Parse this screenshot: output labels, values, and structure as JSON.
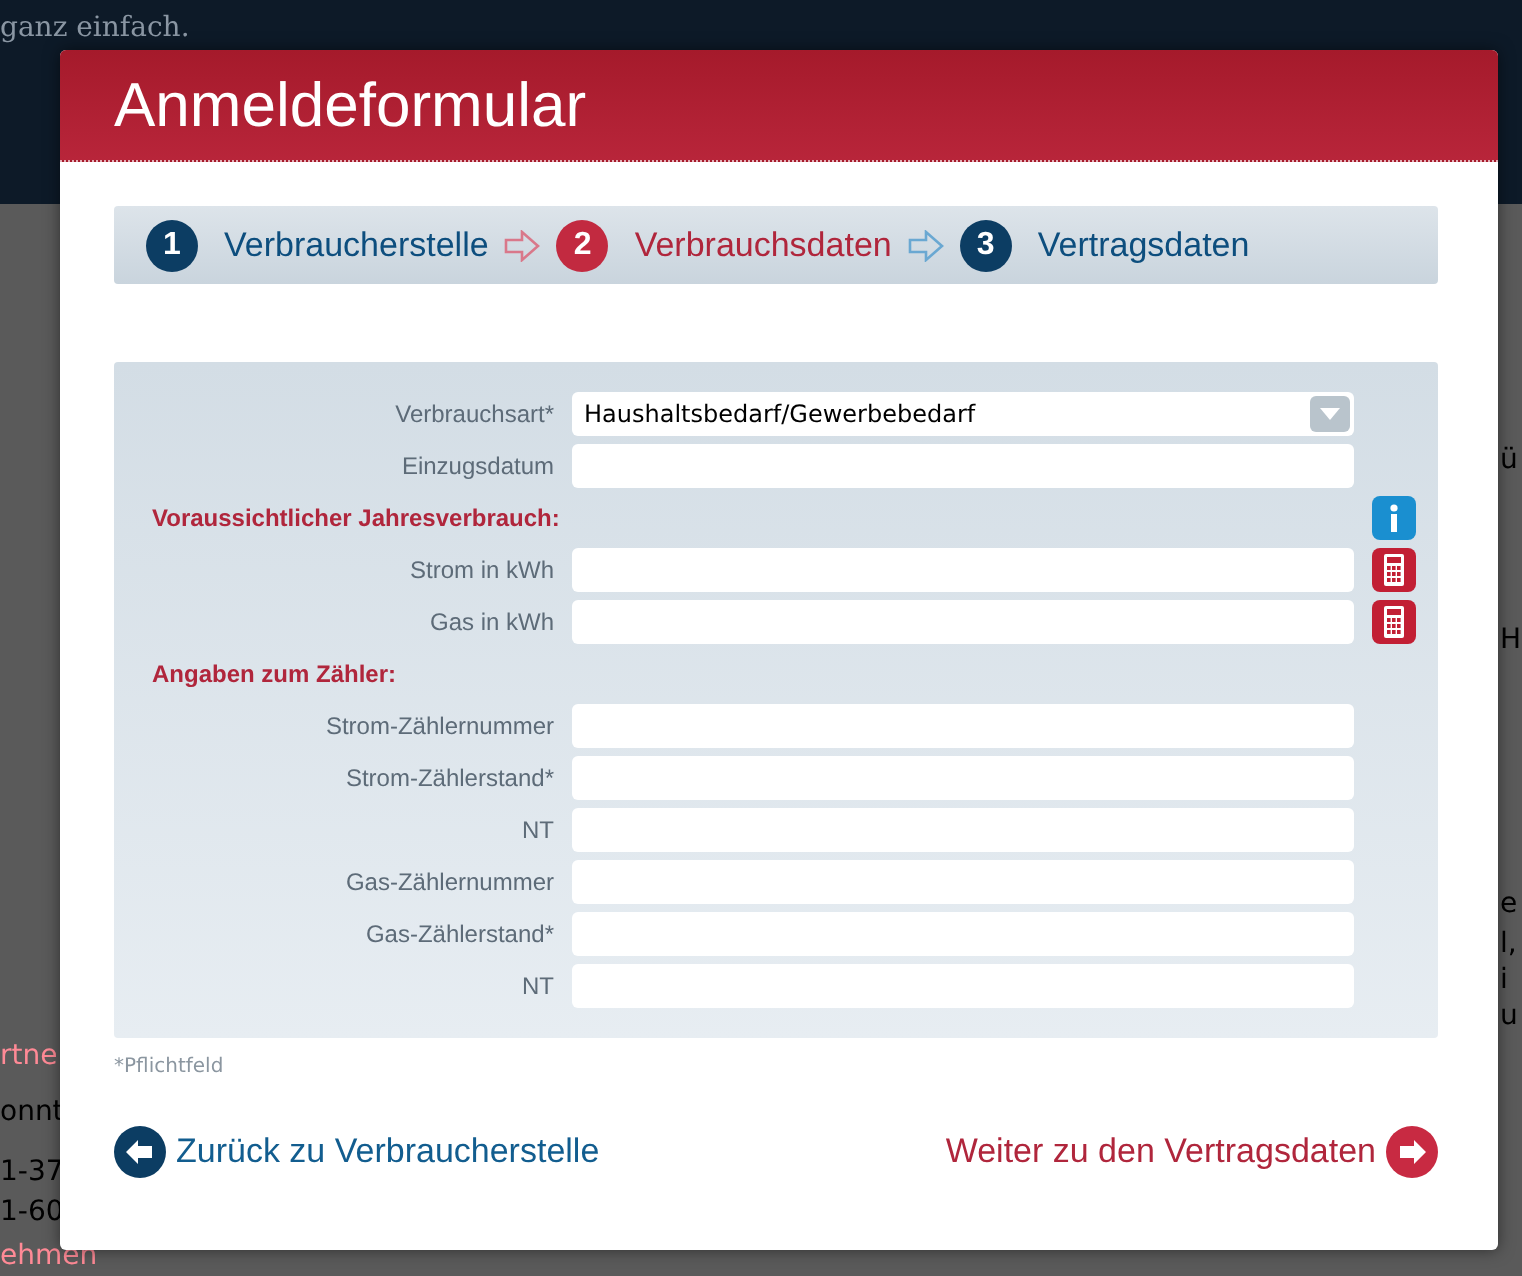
{
  "background": {
    "fragments": [
      "ganz einfach.",
      "rtne",
      "onnt",
      "1-37",
      "1-60",
      "ehmen",
      "ü",
      "H",
      "e",
      "l,",
      "i",
      "u"
    ]
  },
  "dialog": {
    "title": "Anmeldeformular"
  },
  "steps": [
    {
      "number": "1",
      "label": "Verbraucherstelle",
      "selected": false
    },
    {
      "number": "2",
      "label": "Verbrauchsdaten",
      "selected": true
    },
    {
      "number": "3",
      "label": "Vertragsdaten",
      "selected": false
    }
  ],
  "form": {
    "rows": [
      {
        "kind": "select",
        "label": "Verbrauchsart*",
        "value": "Haushaltsbedarf/Gewerbebedarf"
      },
      {
        "kind": "input",
        "label": "Einzugsdatum"
      },
      {
        "kind": "section",
        "label": "Voraussichtlicher Jahresverbrauch:"
      },
      {
        "kind": "input",
        "label": "Strom in kWh"
      },
      {
        "kind": "input",
        "label": "Gas in kWh"
      },
      {
        "kind": "section",
        "label": "Angaben zum Zähler:"
      },
      {
        "kind": "input",
        "label": "Strom-Zählernummer"
      },
      {
        "kind": "input",
        "label": "Strom-Zählerstand*"
      },
      {
        "kind": "input",
        "label": "NT"
      },
      {
        "kind": "input",
        "label": "Gas-Zählernummer"
      },
      {
        "kind": "input",
        "label": "Gas-Zählerstand*"
      },
      {
        "kind": "input",
        "label": "NT"
      }
    ]
  },
  "note": "*Pflichtfeld",
  "nav": {
    "back": "Zurück zu Verbraucherstelle",
    "next": "Weiter zu den Vertragsdaten"
  }
}
